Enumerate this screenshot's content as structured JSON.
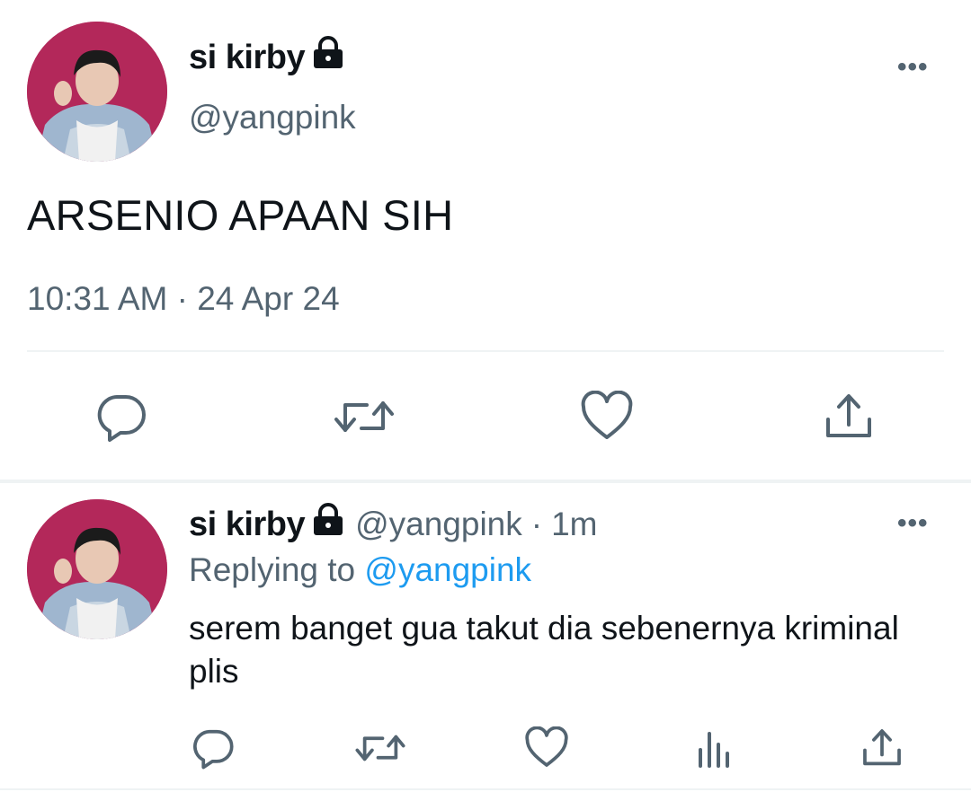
{
  "tweet": {
    "display_name": "si kirby",
    "handle": "@yangpink",
    "text": "ARSENIO APAAN SIH",
    "time": "10:31 AM",
    "separator": "·",
    "date": "24 Apr 24",
    "more": "•••"
  },
  "reply": {
    "display_name": "si kirby",
    "handle": "@yangpink",
    "separator": "·",
    "age": "1m",
    "replying_prefix": "Replying to",
    "replying_handle": "@yangpink",
    "text": "serem banget gua takut dia sebenernya kriminal plis",
    "more": "•••"
  },
  "icons": {
    "main_actions": [
      "reply-icon",
      "retweet-icon",
      "like-icon",
      "share-icon"
    ],
    "reply_actions": [
      "reply-icon",
      "retweet-icon",
      "like-icon",
      "analytics-icon",
      "share-icon"
    ],
    "lock": "lock-icon"
  },
  "colors": {
    "text": "#0f1419",
    "secondary": "#536471",
    "link": "#1d9bf0",
    "divider": "#eff3f4",
    "avatar_bg": "#b3285a"
  }
}
